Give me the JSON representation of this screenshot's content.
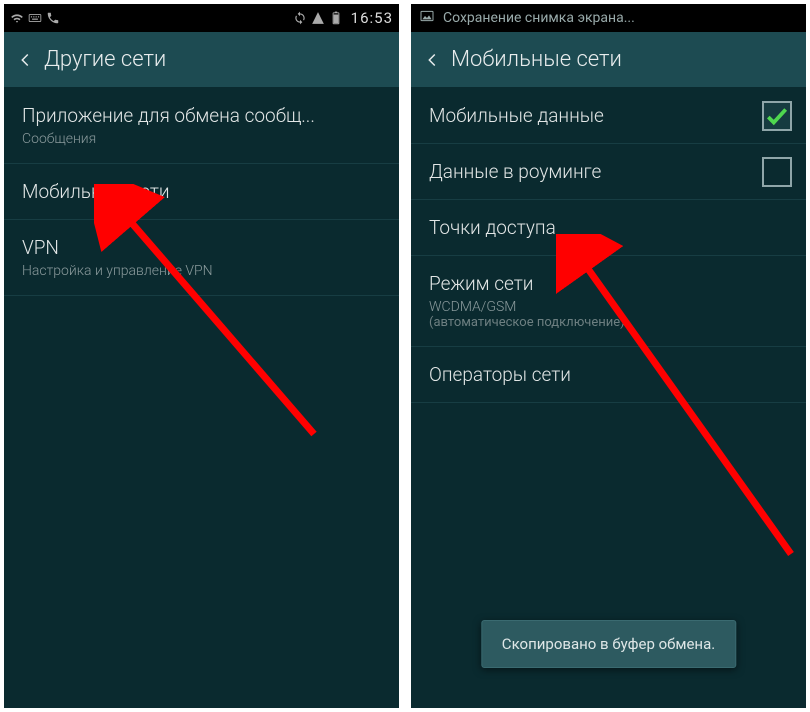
{
  "left": {
    "statusbar": {
      "time": "16:53"
    },
    "header": {
      "title": "Другие сети"
    },
    "rows": [
      {
        "title": "Приложение для обмена сообщ...",
        "sub": "Сообщения"
      },
      {
        "title": "Мобильные сети"
      },
      {
        "title": "VPN",
        "sub": "Настройка и управление VPN"
      }
    ]
  },
  "right": {
    "banner": "Сохранение снимка экрана...",
    "header": {
      "title": "Мобильные сети"
    },
    "rows": [
      {
        "title": "Мобильные данные",
        "checked": true
      },
      {
        "title": "Данные в роуминге",
        "checked": false
      },
      {
        "title": "Точки доступа"
      },
      {
        "title": "Режим сети",
        "sub": "WCDMA/GSM",
        "sub2": "(автоматическое подключение)"
      },
      {
        "title": "Операторы сети"
      }
    ],
    "toast": "Скопировано в буфер обмена."
  }
}
